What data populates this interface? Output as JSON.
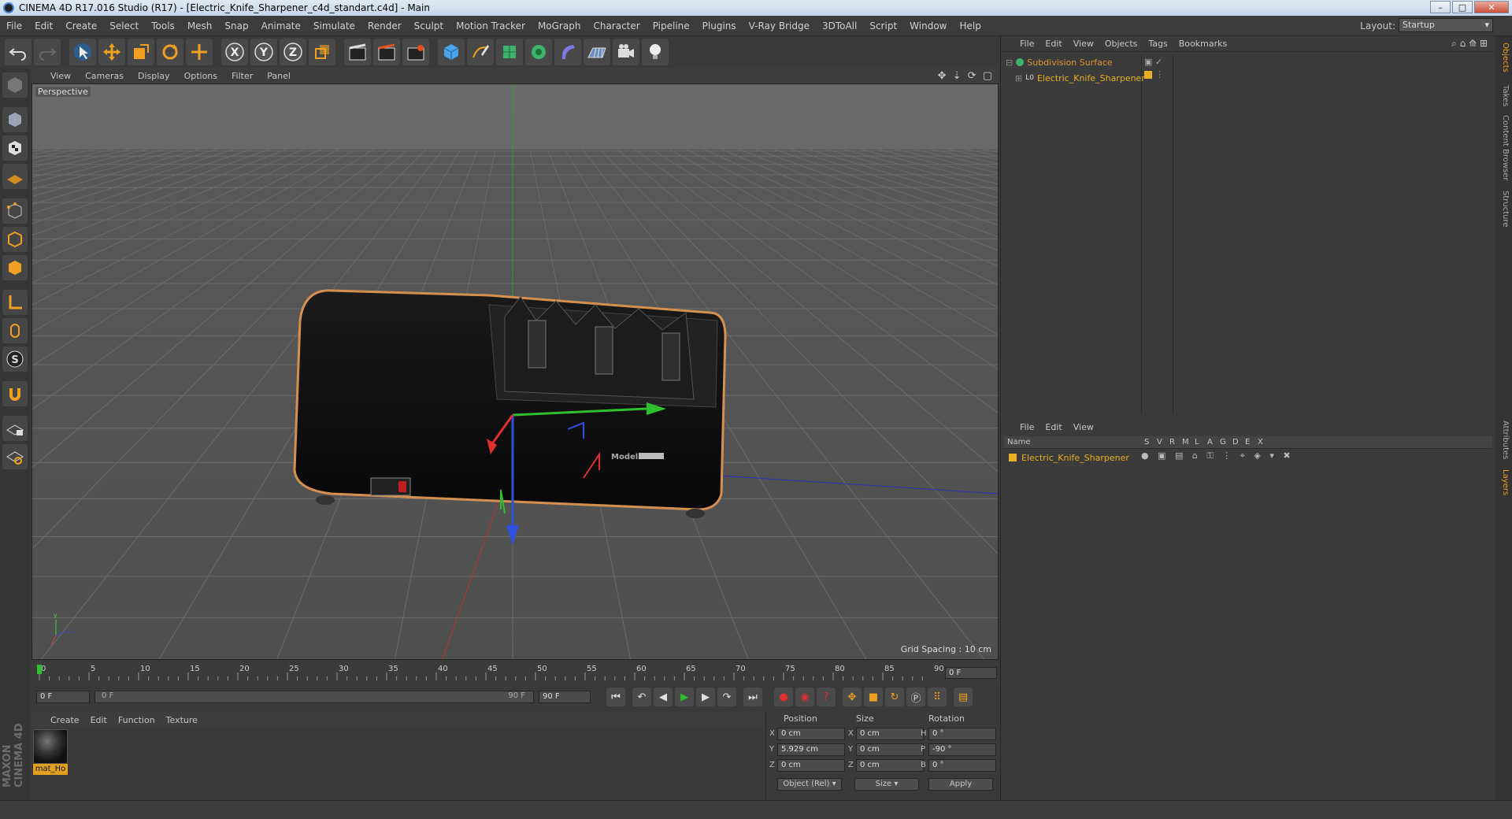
{
  "window": {
    "title": "CINEMA 4D R17.016 Studio (R17) - [Electric_Knife_Sharpener_c4d_standart.c4d] - Main",
    "buttons": [
      "–",
      "□",
      "✕"
    ]
  },
  "menu": [
    "File",
    "Edit",
    "Create",
    "Select",
    "Tools",
    "Mesh",
    "Snap",
    "Animate",
    "Simulate",
    "Render",
    "Sculpt",
    "Motion Tracker",
    "MoGraph",
    "Character",
    "Pipeline",
    "Plugins",
    "V-Ray Bridge",
    "3DToAll",
    "Script",
    "Window",
    "Help"
  ],
  "layout": {
    "label": "Layout:",
    "value": "Startup"
  },
  "toolbar": {
    "axis_labels": [
      "X",
      "Y",
      "Z"
    ]
  },
  "viewport": {
    "menu": [
      "View",
      "Cameras",
      "Display",
      "Options",
      "Filter",
      "Panel"
    ],
    "camera_label": "Perspective",
    "grid_spacing": "Grid Spacing : 10 cm",
    "model_label": "Model"
  },
  "timeline": {
    "ticks": [
      "0",
      "5",
      "10",
      "15",
      "20",
      "25",
      "30",
      "35",
      "40",
      "45",
      "50",
      "55",
      "60",
      "65",
      "70",
      "75",
      "80",
      "85",
      "90"
    ],
    "end_field": "0 F",
    "current_frame": "0 F",
    "range_start": "0 F",
    "range_end": "90 F",
    "max_frame": "90 F"
  },
  "material_manager": {
    "menu": [
      "Create",
      "Edit",
      "Function",
      "Texture"
    ],
    "materials": [
      {
        "name": "mat_Ho"
      }
    ]
  },
  "coordinates": {
    "headers": [
      "Position",
      "Size",
      "Rotation"
    ],
    "rows": [
      {
        "axis": "X",
        "position": "0 cm",
        "size_axis": "X",
        "size": "0 cm",
        "rot_axis": "H",
        "rotation": "0 °"
      },
      {
        "axis": "Y",
        "position": "5.929 cm",
        "size_axis": "Y",
        "size": "0 cm",
        "rot_axis": "P",
        "rotation": "-90 °"
      },
      {
        "axis": "Z",
        "position": "0 cm",
        "size_axis": "Z",
        "size": "0 cm",
        "rot_axis": "B",
        "rotation": "0 °"
      }
    ],
    "mode_select": "Object (Rel)",
    "size_select": "Size",
    "apply_label": "Apply"
  },
  "object_manager": {
    "menu": [
      "File",
      "Edit",
      "View",
      "Objects",
      "Tags",
      "Bookmarks"
    ],
    "objects": [
      {
        "name": "Subdivision Surface",
        "color": "#d99a2b"
      },
      {
        "name": "Electric_Knife_Sharpener",
        "color": "#e8b020"
      }
    ]
  },
  "layer_manager": {
    "menu": [
      "File",
      "Edit",
      "View"
    ],
    "columns": [
      "Name",
      "S",
      "V",
      "R",
      "M",
      "L",
      "A",
      "G",
      "D",
      "E",
      "X"
    ],
    "layers": [
      {
        "name": "Electric_Knife_Sharpener",
        "color": "#e8b020"
      }
    ]
  },
  "side_tabs": [
    "Objects",
    "Takes",
    "Content Browser",
    "Structure",
    "Attributes",
    "Layers"
  ],
  "brand": "MAXON CINEMA 4D",
  "colors": {
    "accent": "#e8a020",
    "panel": "#3b3b3b",
    "selected_text": "#e8a020"
  }
}
